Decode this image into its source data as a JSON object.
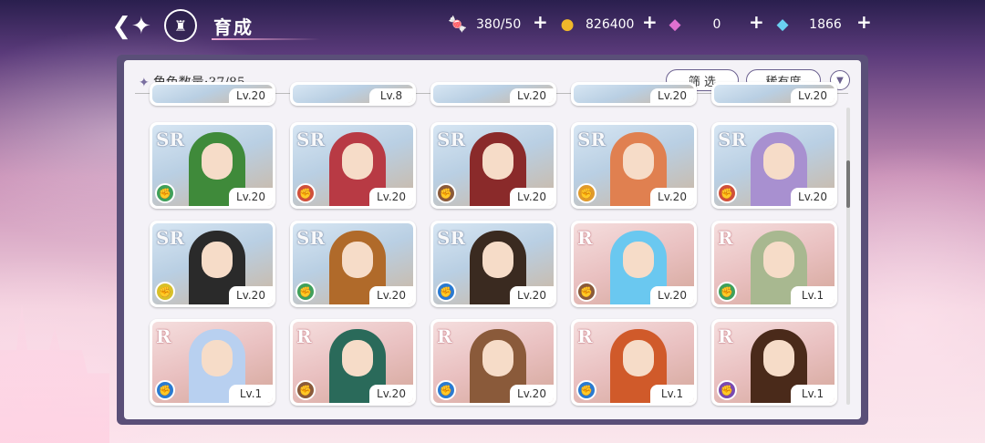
{
  "header": {
    "title": "育成",
    "resources": [
      {
        "name": "stamina",
        "icon": "candy-icon",
        "value": "380/50"
      },
      {
        "name": "gold",
        "icon": "coin-icon",
        "value": "826400"
      },
      {
        "name": "pink-gem",
        "icon": "pink-diamond-icon",
        "value": "0"
      },
      {
        "name": "blue-gem",
        "icon": "blue-diamond-icon",
        "value": "1866"
      }
    ]
  },
  "panel": {
    "count_label": "角色数量:37/85",
    "filter_label": "筛 选",
    "rarity_sort_label": "稀有度"
  },
  "partial_row": [
    {
      "level": "Lv.20"
    },
    {
      "level": "Lv.8"
    },
    {
      "level": "Lv.20"
    },
    {
      "level": "Lv.20"
    },
    {
      "level": "Lv.20"
    }
  ],
  "cards": [
    {
      "rarity": "SR",
      "element": "green",
      "level": "Lv.20",
      "hair": "#3f8a3a"
    },
    {
      "rarity": "SR",
      "element": "red",
      "level": "Lv.20",
      "hair": "#b83a44"
    },
    {
      "rarity": "SR",
      "element": "brown",
      "level": "Lv.20",
      "hair": "#8a2a2a"
    },
    {
      "rarity": "SR",
      "element": "orange",
      "level": "Lv.20",
      "hair": "#e08050"
    },
    {
      "rarity": "SR",
      "element": "red",
      "level": "Lv.20",
      "hair": "#a890d0"
    },
    {
      "rarity": "SR",
      "element": "yellow",
      "level": "Lv.20",
      "hair": "#2a2a2a"
    },
    {
      "rarity": "SR",
      "element": "green",
      "level": "Lv.20",
      "hair": "#b06a2a"
    },
    {
      "rarity": "SR",
      "element": "blue",
      "level": "Lv.20",
      "hair": "#3a2a20"
    },
    {
      "rarity": "R",
      "element": "brown",
      "level": "Lv.20",
      "hair": "#6ac8f0"
    },
    {
      "rarity": "R",
      "element": "green",
      "level": "Lv.1",
      "hair": "#a8b890"
    },
    {
      "rarity": "R",
      "element": "blue",
      "level": "Lv.1",
      "hair": "#b8d0f0"
    },
    {
      "rarity": "R",
      "element": "brown",
      "level": "Lv.20",
      "hair": "#2a6a5a"
    },
    {
      "rarity": "R",
      "element": "blue",
      "level": "Lv.20",
      "hair": "#8a5a3a"
    },
    {
      "rarity": "R",
      "element": "blue",
      "level": "Lv.1",
      "hair": "#d05a2a"
    },
    {
      "rarity": "R",
      "element": "purple",
      "level": "Lv.1",
      "hair": "#4a2a1a"
    }
  ],
  "element_colors": {
    "green": "#3fa05a",
    "red": "#d0503a",
    "brown": "#8a5a3a",
    "orange": "#e09a2a",
    "yellow": "#d8c02a",
    "blue": "#2a7ad0",
    "purple": "#7a4ab0"
  }
}
